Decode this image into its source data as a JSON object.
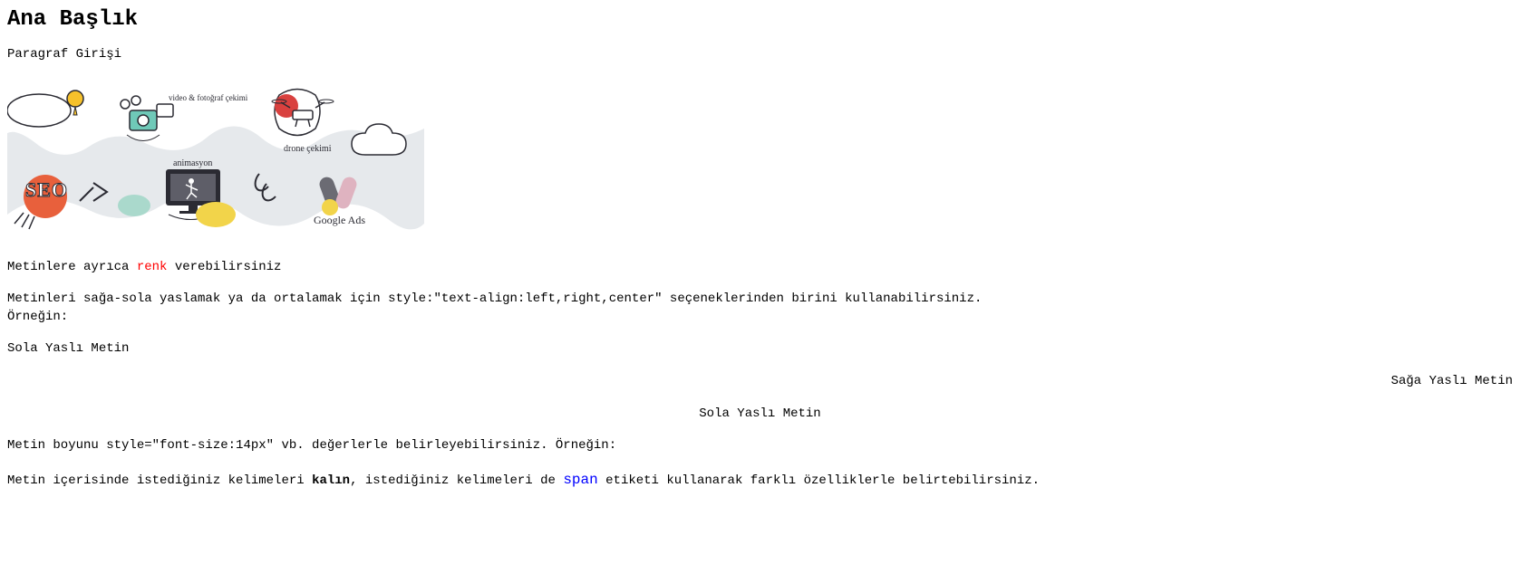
{
  "heading": "Ana Başlık",
  "intro": "Paragraf Girişi",
  "illustration": {
    "labels": {
      "video": "video & fotoğraf çekimi",
      "drone": "drone çekimi",
      "animation": "animasyon",
      "seo": "SEO",
      "ads": "Google Ads"
    }
  },
  "colorLine": {
    "before": "Metinlere ayrıca ",
    "colored": "renk",
    "after": " verebilirsiniz"
  },
  "alignInstruction": "Metinleri sağa-sola yaslamak ya da ortalamak için style:\"text-align:left,right,center\" seçeneklerinden birini kullanabilirsiniz.",
  "exampleLabel": "Örneğin:",
  "leftText": "Sola Yaslı Metin",
  "rightText": "Sağa Yaslı Metin",
  "centerText": "Sola Yaslı Metin",
  "fontSizeLine": "Metin boyunu style=\"font-size:14px\" vb. değerlerle belirleyebilirsiniz. Örneğin:",
  "inlineLine": {
    "p1": "Metin içerisinde istediğiniz kelimeleri ",
    "bold": "kalın",
    "p2": ", istediğiniz kelimeleri de ",
    "span": "span",
    "p3": " etiketi kullanarak farklı özelliklerle belirtebilirsiniz."
  }
}
